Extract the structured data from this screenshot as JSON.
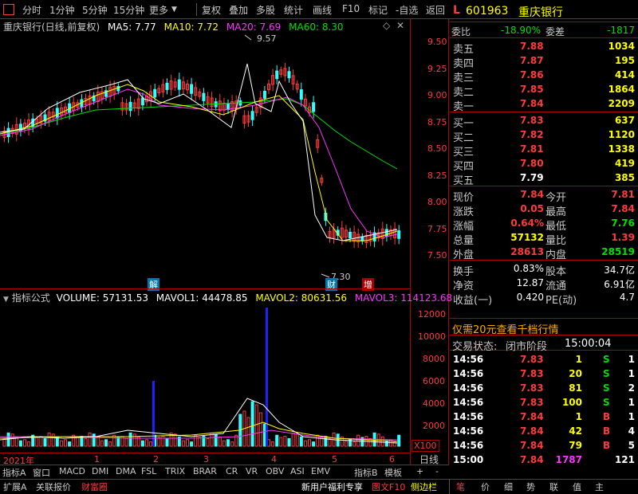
{
  "toolbar": {
    "items": [
      "分时",
      "1分钟",
      "5分钟",
      "15分钟",
      "更多",
      "复权",
      "叠加",
      "多股",
      "统计",
      "画线",
      "F10",
      "标记",
      "-自选",
      "返回"
    ]
  },
  "chart_header": {
    "name": "重庆银行(日线,前复权)",
    "ma5": "MA5: 7.77",
    "ma10": "MA10: 7.72",
    "ma20": "MA20: 7.69",
    "ma60": "MA60: 8.30"
  },
  "price_axis": [
    "9.50",
    "9.25",
    "9.00",
    "8.75",
    "8.50",
    "8.25",
    "8.00",
    "7.75",
    "7.50"
  ],
  "annotations": {
    "high": "9.57",
    "low": "7.30",
    "jie": "解",
    "cai": "财",
    "zeng": "增"
  },
  "indicator_header": {
    "name": "指标公式",
    "volume": "VOLUME: 57131.53",
    "mavol1": "MAVOL1: 44478.85",
    "mavol2": "MAVOL2: 80631.56",
    "mavol3": "MAVOL3: 114123.68"
  },
  "volume_axis": [
    "12000",
    "10000",
    "8000",
    "6000",
    "4000",
    "2000"
  ],
  "volume_unit": "X100",
  "date_axis": {
    "year": "2021年",
    "m1": "1",
    "m2": "2",
    "m3": "3",
    "m4": "4",
    "m5": "5",
    "m6": "6"
  },
  "period_label": "日线",
  "indicator_tabs": [
    "指标A",
    "窗口",
    "MACD",
    "DMI",
    "DMA",
    "FSL",
    "TRIX",
    "BRAR",
    "CR",
    "VR",
    "OBV",
    "ASI",
    "EMV",
    "指标B",
    "模板",
    "+",
    "-"
  ],
  "status_tabs": [
    "扩展A",
    "关联报价",
    "财富圈"
  ],
  "status_right": [
    "新用户福利专享",
    "图文F10",
    "侧边栏"
  ],
  "side_nav": [
    "笔",
    "价",
    "细",
    "势",
    "联",
    "值",
    "主"
  ],
  "stock": {
    "code": "601963",
    "name": "重庆银行",
    "label_l": "L"
  },
  "weibi": {
    "label": "委比",
    "value": "-18.90%",
    "diff_label": "委差",
    "diff": "-1817"
  },
  "sell": [
    {
      "label": "卖五",
      "price": "7.88",
      "vol": "1034"
    },
    {
      "label": "卖四",
      "price": "7.87",
      "vol": "195"
    },
    {
      "label": "卖三",
      "price": "7.86",
      "vol": "414"
    },
    {
      "label": "卖二",
      "price": "7.85",
      "vol": "1864"
    },
    {
      "label": "卖一",
      "price": "7.84",
      "vol": "2209"
    }
  ],
  "buy": [
    {
      "label": "买一",
      "price": "7.83",
      "vol": "637"
    },
    {
      "label": "买二",
      "price": "7.82",
      "vol": "1120"
    },
    {
      "label": "买三",
      "price": "7.81",
      "vol": "1338"
    },
    {
      "label": "买四",
      "price": "7.80",
      "vol": "419"
    },
    {
      "label": "买五",
      "price": "7.79",
      "vol": "385"
    }
  ],
  "quote": [
    {
      "l1": "现价",
      "v1": "7.84",
      "l2": "今开",
      "v2": "7.81"
    },
    {
      "l1": "涨跌",
      "v1": "0.05",
      "l2": "最高",
      "v2": "7.84"
    },
    {
      "l1": "涨幅",
      "v1": "0.64%",
      "l2": "最低",
      "v2": "7.76"
    },
    {
      "l1": "总量",
      "v1": "57132",
      "l2": "量比",
      "v2": "1.39"
    },
    {
      "l1": "外盘",
      "v1": "28613",
      "l2": "内盘",
      "v2": "28519"
    }
  ],
  "stats": [
    {
      "l1": "换手",
      "v1": "0.83%",
      "l2": "股本",
      "v2": "34.7亿"
    },
    {
      "l1": "净资",
      "v1": "12.87",
      "l2": "流通",
      "v2": "6.91亿"
    },
    {
      "l1": "收益(一)",
      "v1": "0.420",
      "l2": "PE(动)",
      "v2": "4.7"
    }
  ],
  "promo": "仅需20元查看千档行情",
  "trade_status": {
    "label": "交易状态:",
    "value": "闭市阶段",
    "time": "15:00:04"
  },
  "ticks": [
    {
      "t": "14:56",
      "p": "7.83",
      "v": "1",
      "f": "S",
      "n": "1"
    },
    {
      "t": "14:56",
      "p": "7.83",
      "v": "20",
      "f": "S",
      "n": "1"
    },
    {
      "t": "14:56",
      "p": "7.83",
      "v": "81",
      "f": "S",
      "n": "2"
    },
    {
      "t": "14:56",
      "p": "7.83",
      "v": "100",
      "f": "S",
      "n": "1"
    },
    {
      "t": "14:56",
      "p": "7.84",
      "v": "1",
      "f": "B",
      "n": "1"
    },
    {
      "t": "14:56",
      "p": "7.84",
      "v": "42",
      "f": "B",
      "n": "4"
    },
    {
      "t": "14:56",
      "p": "7.84",
      "v": "79",
      "f": "B",
      "n": "5"
    },
    {
      "t": "15:00",
      "p": "7.84",
      "v": "1787",
      "f": "",
      "n": "121"
    }
  ],
  "chart_data": {
    "type": "candlestick",
    "price_range": [
      7.3,
      9.6
    ],
    "ma_lines": [
      "MA5",
      "MA10",
      "MA20",
      "MA60"
    ],
    "volume_range": [
      0,
      13000
    ],
    "colors": {
      "ma5": "#ffffff",
      "ma10": "#ffff00",
      "ma20": "#ff33ff",
      "ma60": "#00e000",
      "up": "#ff3b3b",
      "down": "#33ffff",
      "peak": "#2020ff"
    }
  }
}
